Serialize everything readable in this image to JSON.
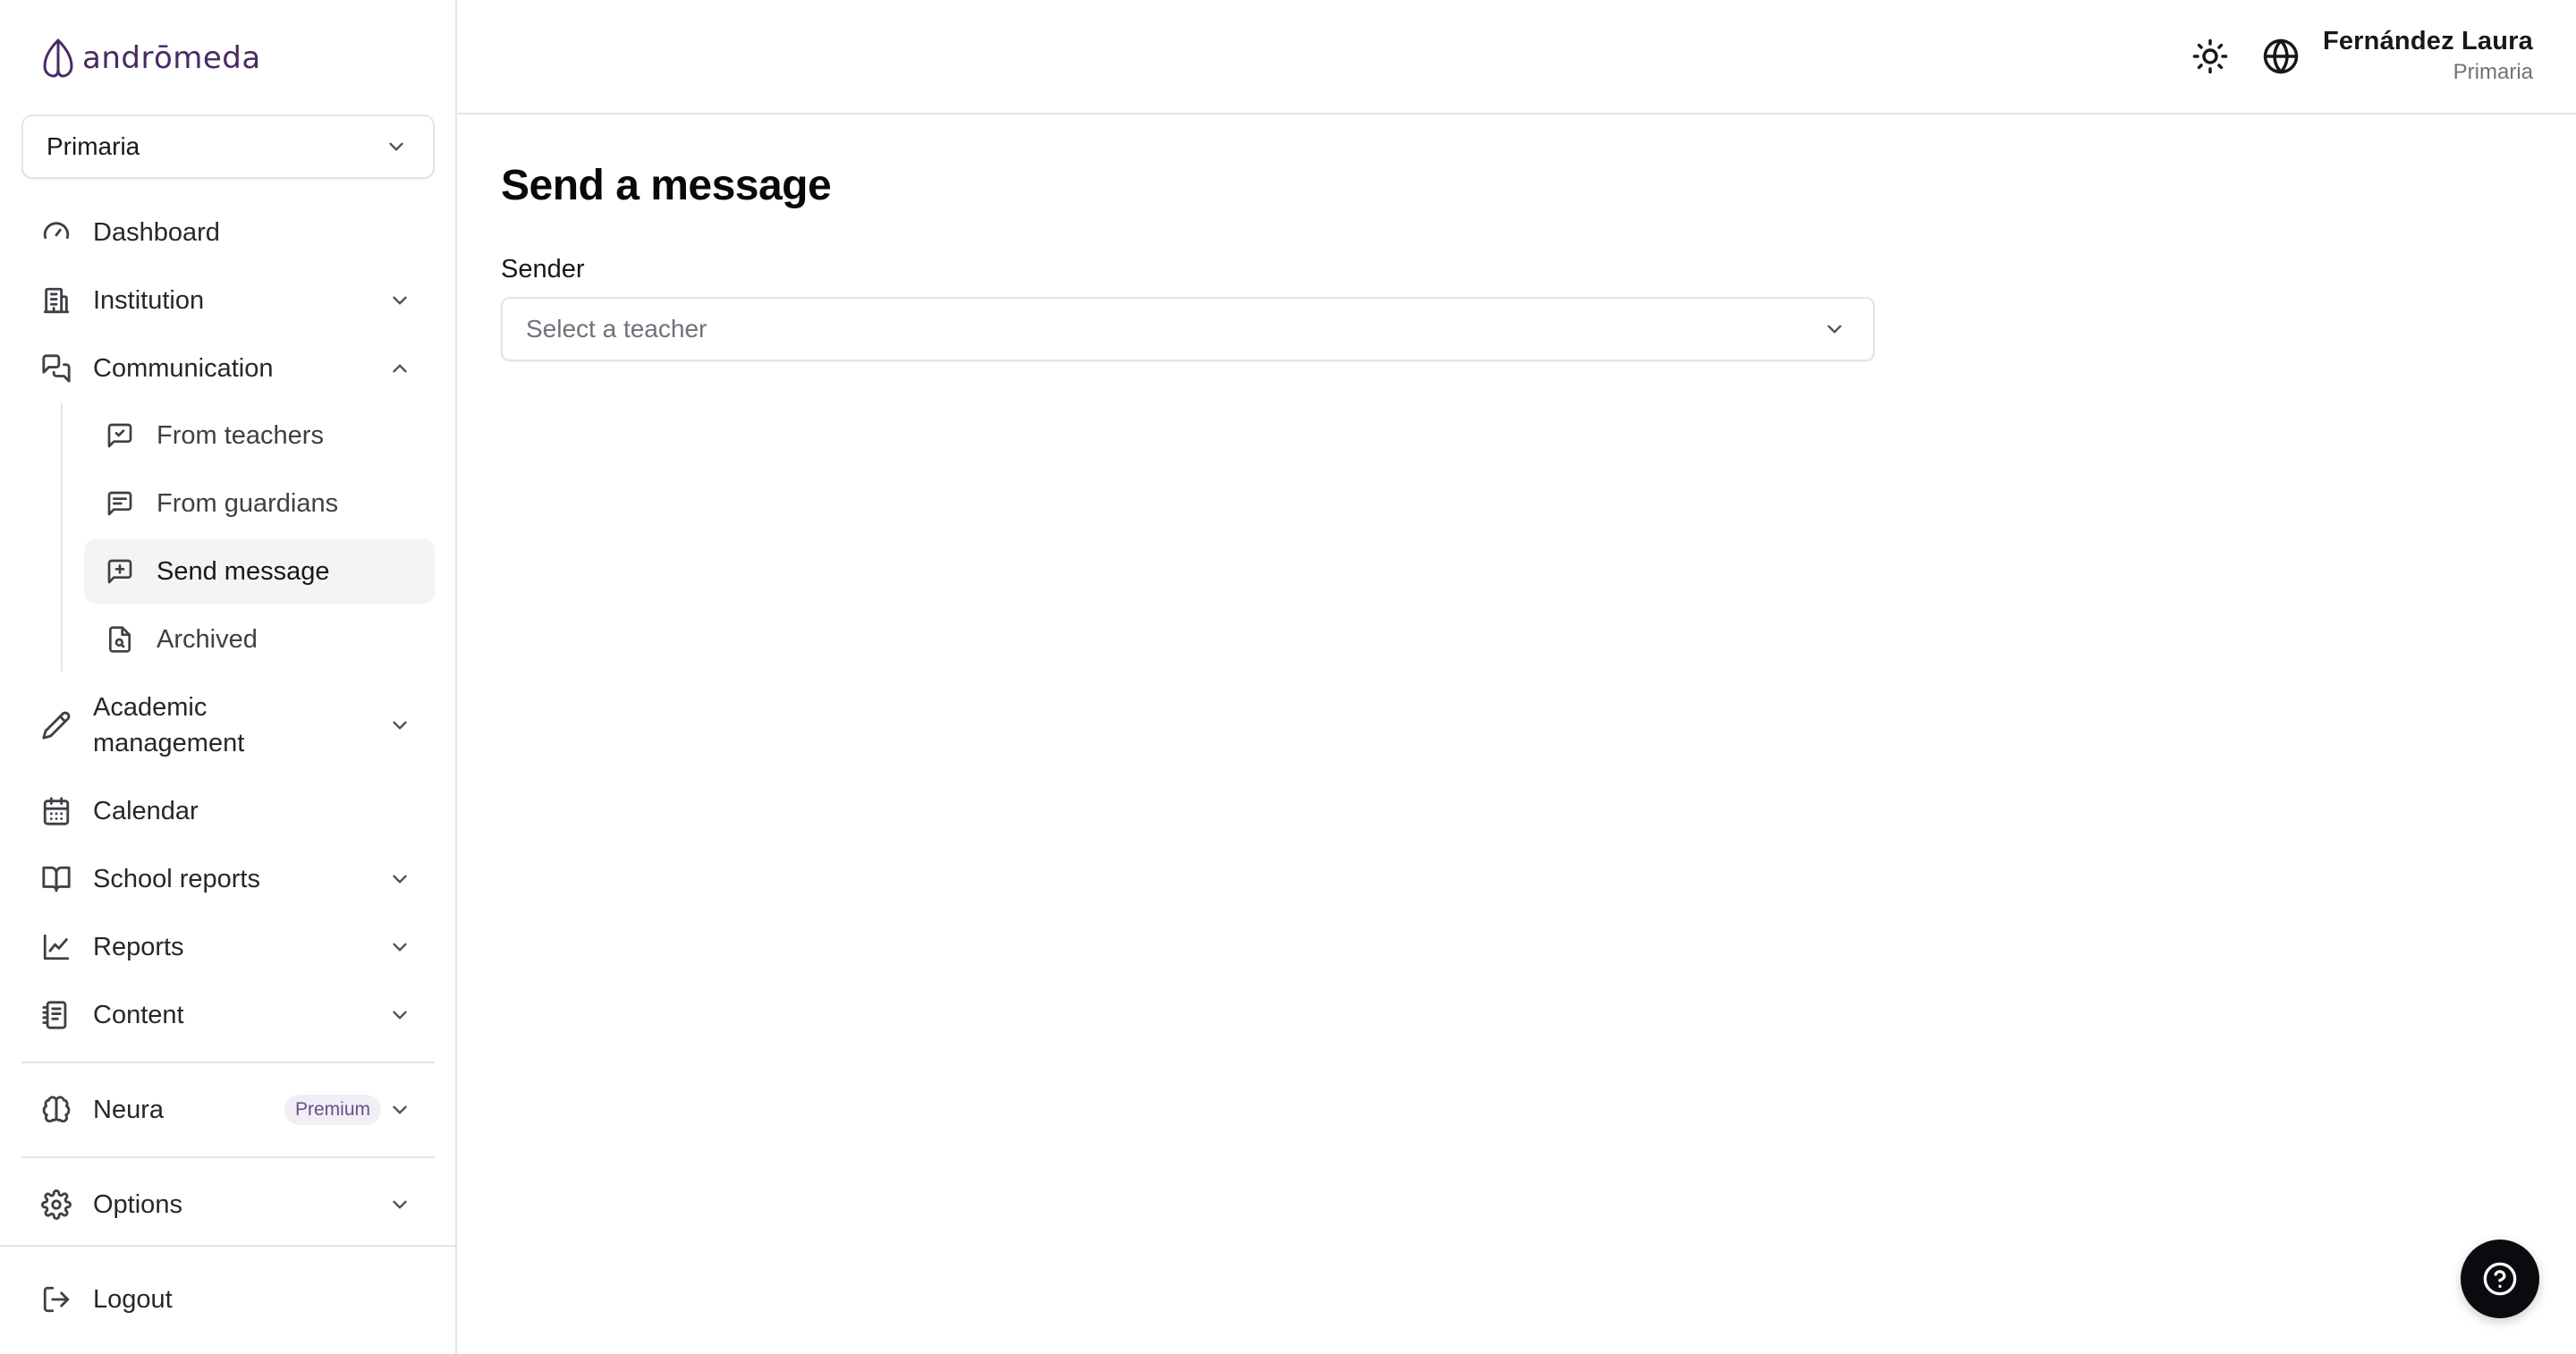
{
  "brand": {
    "logo_text": "andrōmeda",
    "logo_color": "#4a2a63"
  },
  "school_selector": {
    "value": "Primaria"
  },
  "sidebar": {
    "items": [
      {
        "label": "Dashboard",
        "icon": "gauge-icon"
      },
      {
        "label": "Institution",
        "icon": "building-icon",
        "expandable": true
      },
      {
        "label": "Communication",
        "icon": "messages-icon",
        "expanded": true,
        "children": [
          {
            "label": "From teachers",
            "icon": "message-check-icon"
          },
          {
            "label": "From guardians",
            "icon": "message-text-icon"
          },
          {
            "label": "Send message",
            "icon": "message-plus-icon",
            "active": true
          },
          {
            "label": "Archived",
            "icon": "file-search-icon"
          }
        ]
      },
      {
        "label": "Academic management",
        "icon": "pencil-icon",
        "expandable": true
      },
      {
        "label": "Calendar",
        "icon": "calendar-icon"
      },
      {
        "label": "School reports",
        "icon": "book-open-icon",
        "expandable": true
      },
      {
        "label": "Reports",
        "icon": "line-chart-icon",
        "expandable": true
      },
      {
        "label": "Content",
        "icon": "notebook-icon",
        "expandable": true
      }
    ],
    "neura": {
      "label": "Neura",
      "badge": "Premium",
      "icon": "brain-icon"
    },
    "options": {
      "label": "Options",
      "icon": "settings-icon"
    },
    "logout": {
      "label": "Logout",
      "icon": "logout-icon"
    }
  },
  "header": {
    "user_name": "Fernández Laura",
    "user_role": "Primaria"
  },
  "main": {
    "title": "Send a message",
    "sender_label": "Sender",
    "sender_placeholder": "Select a teacher"
  },
  "colors": {
    "accent": "#4a2a63",
    "active_bg": "#f4f4f5",
    "badge_bg": "#f1eef6",
    "badge_text": "#6b4e8a"
  }
}
